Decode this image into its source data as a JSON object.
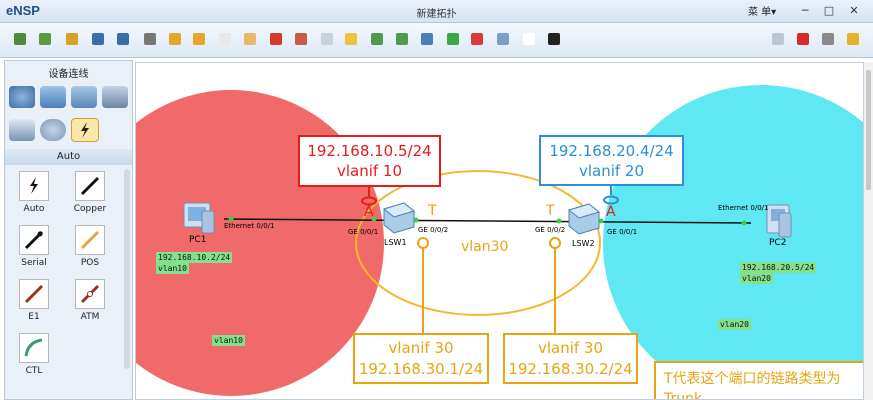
{
  "app": {
    "logo": "eNSP",
    "window_title": "新建拓扑",
    "menu_label": "菜 单▾"
  },
  "window_controls": [
    "─",
    "□",
    "✕"
  ],
  "toolbar": {
    "left_icons": [
      "new-topology-icon",
      "new-example-icon",
      "open-icon",
      "save-icon",
      "save-as-icon",
      "print-icon",
      "undo-icon",
      "redo-icon",
      "select-icon",
      "pan-icon",
      "delete-icon",
      "delete-link-icon",
      "text-icon",
      "palette-icon",
      "zoom-in-icon",
      "zoom-out-icon",
      "fit-icon",
      "start-icon",
      "stop-icon",
      "capture-icon",
      "grid-icon",
      "screenshot-icon"
    ],
    "right_icons": [
      "chat-icon",
      "huawei-icon",
      "settings-icon",
      "help-icon"
    ]
  },
  "sidebar": {
    "title": "设备连线",
    "device_icons": [
      "router-icon",
      "switch-icon",
      "wlan-icon",
      "firewall-icon",
      "pc-icon",
      "cloud-icon",
      "cable-icon"
    ],
    "section_label": "Auto",
    "cables": [
      {
        "label": "Auto",
        "icon": "auto-cable-icon"
      },
      {
        "label": "Copper",
        "icon": "copper-cable-icon"
      },
      {
        "label": "Serial",
        "icon": "serial-cable-icon"
      },
      {
        "label": "POS",
        "icon": "pos-cable-icon"
      },
      {
        "label": "E1",
        "icon": "e1-cable-icon"
      },
      {
        "label": "ATM",
        "icon": "atm-cable-icon"
      },
      {
        "label": "CTL",
        "icon": "ctl-cable-icon"
      }
    ]
  },
  "topology": {
    "pc1": {
      "name": "PC1",
      "port": "Ethernet 0/0/1",
      "ip": "192.168.10.2/24",
      "vlan": "vlan10"
    },
    "pc2": {
      "name": "PC2",
      "port": "Ethernet 0/0/1",
      "ip": "192.168.20.5/24",
      "vlan": "vlan20"
    },
    "lsw1": {
      "name": "LSW1",
      "port_pc": "GE 0/0/1",
      "port_trunk": "GE 0/0/2"
    },
    "lsw2": {
      "name": "LSW2",
      "port_trunk": "GE 0/0/2",
      "port_pc": "GE 0/0/1"
    },
    "zone_vlan10": "vlan10",
    "zone_vlan20": "vlan20",
    "zone_vlan30": "vlan30",
    "mark_access": "A",
    "mark_trunk": "T",
    "box_lsw1_vlanif10": {
      "ip": "192.168.10.5/24",
      "vlanif": "vlanif 10"
    },
    "box_lsw2_vlanif20": {
      "ip": "192.168.20.4/24",
      "vlanif": "vlanif 20"
    },
    "box_lsw1_vlanif30": {
      "vlanif": "vlanif 30",
      "ip": "192.168.30.1/24"
    },
    "box_lsw2_vlanif30": {
      "vlanif": "vlanif 30",
      "ip": "192.168.30.2/24"
    },
    "note": "T代表这个端口的链路类型为Trunk",
    "colors": {
      "vlan10": "#f06a6a",
      "vlan20": "#5fe7f3",
      "vlan30": "#f2b830",
      "red": "#e51c1c",
      "blue": "#2a8fd8",
      "orange": "#e9a511"
    }
  }
}
